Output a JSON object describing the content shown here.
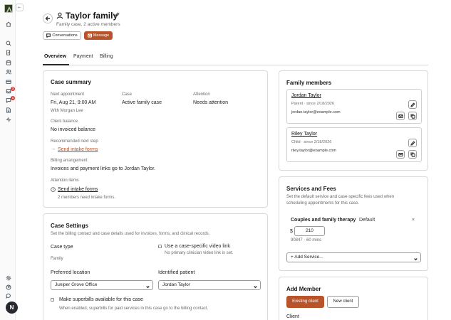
{
  "sidebar": {
    "collapse_label": "⇤",
    "icons": [
      "home-icon",
      "search-icon",
      "edit-note-icon",
      "calendar-icon",
      "users-icon",
      "credit-card-icon",
      "inbox-icon",
      "message-icon",
      "document-icon",
      "activity-icon",
      "settings-icon",
      "help-icon",
      "chat-icon"
    ],
    "inbox_badge": "3",
    "messages_badge": "1",
    "avatar_initial": "N"
  },
  "header": {
    "title": "Taylor family",
    "subtitle": "Family case, 2 active members",
    "conversations_label": "Conversations",
    "message_label": "Message"
  },
  "tabs": [
    "Overview",
    "Payment",
    "Billing"
  ],
  "case_summary": {
    "title": "Case summary",
    "next_appointment_label": "Next appointment",
    "next_appointment_value": "Fri, Aug 21, 9:00 AM",
    "with_clinician": "With Morgan Lee",
    "case_label": "Case",
    "case_value": "Active family case",
    "attention_label": "Attention",
    "attention_value": "Needs attention",
    "client_balance_label": "Client balance",
    "client_balance_value": "No invoiced balance",
    "next_step_label": "Recommended next step",
    "next_step_arrow": "→",
    "next_step_link": "Send intake forms",
    "billing_arrangement_label": "Billing arrangement",
    "billing_arrangement_value": "Invoices and payment links go to Jordan Taylor.",
    "attention_items_label": "Attention items",
    "attention_item_link": "Send intake forms",
    "attention_item_detail": "2 members need intake forms."
  },
  "case_settings": {
    "title": "Case Settings",
    "description": "Set the billing contact and case details used for invoices, forms, and clinical records.",
    "case_type_label": "Case type",
    "case_type_value": "Family",
    "video_link_label": "Use a case-specific video link",
    "video_link_note": "No primary clinician video link is set.",
    "preferred_location_label": "Preferred location",
    "preferred_location_value": "Juniper Grove Office",
    "identified_patient_label": "Identified patient",
    "identified_patient_value": "Jordan Taylor",
    "superbills_label": "Make superbills available for this case",
    "superbills_note": "When enabled, superbills for paid services in this case go to the billing contact."
  },
  "family_members": {
    "title": "Family members",
    "members": [
      {
        "name": "Jordan Taylor",
        "meta": "Parent · since 2/18/2026",
        "email": "jordan.taylor@example.com"
      },
      {
        "name": "Riley Taylor",
        "meta": "Child · since 2/18/2026",
        "email": "riley.taylor@example.com"
      }
    ]
  },
  "services_fees": {
    "title": "Services and Fees",
    "description_line1": "Set the default service and case-specific fees used when",
    "description_line2": "scheduling appointments for this case.",
    "service_name": "Couples and family therapy",
    "default_tag": "Default",
    "remove_symbol": "×",
    "currency": "$",
    "fee": "210",
    "service_code": "90847 · 60 mins",
    "add_service_placeholder": "+ Add Service..."
  },
  "add_member": {
    "title": "Add Member",
    "existing_client_label": "Existing client",
    "new_client_label": "New client",
    "client_label": "Client"
  },
  "colors": {
    "accent": "#b9542a",
    "badge": "#d93636"
  }
}
